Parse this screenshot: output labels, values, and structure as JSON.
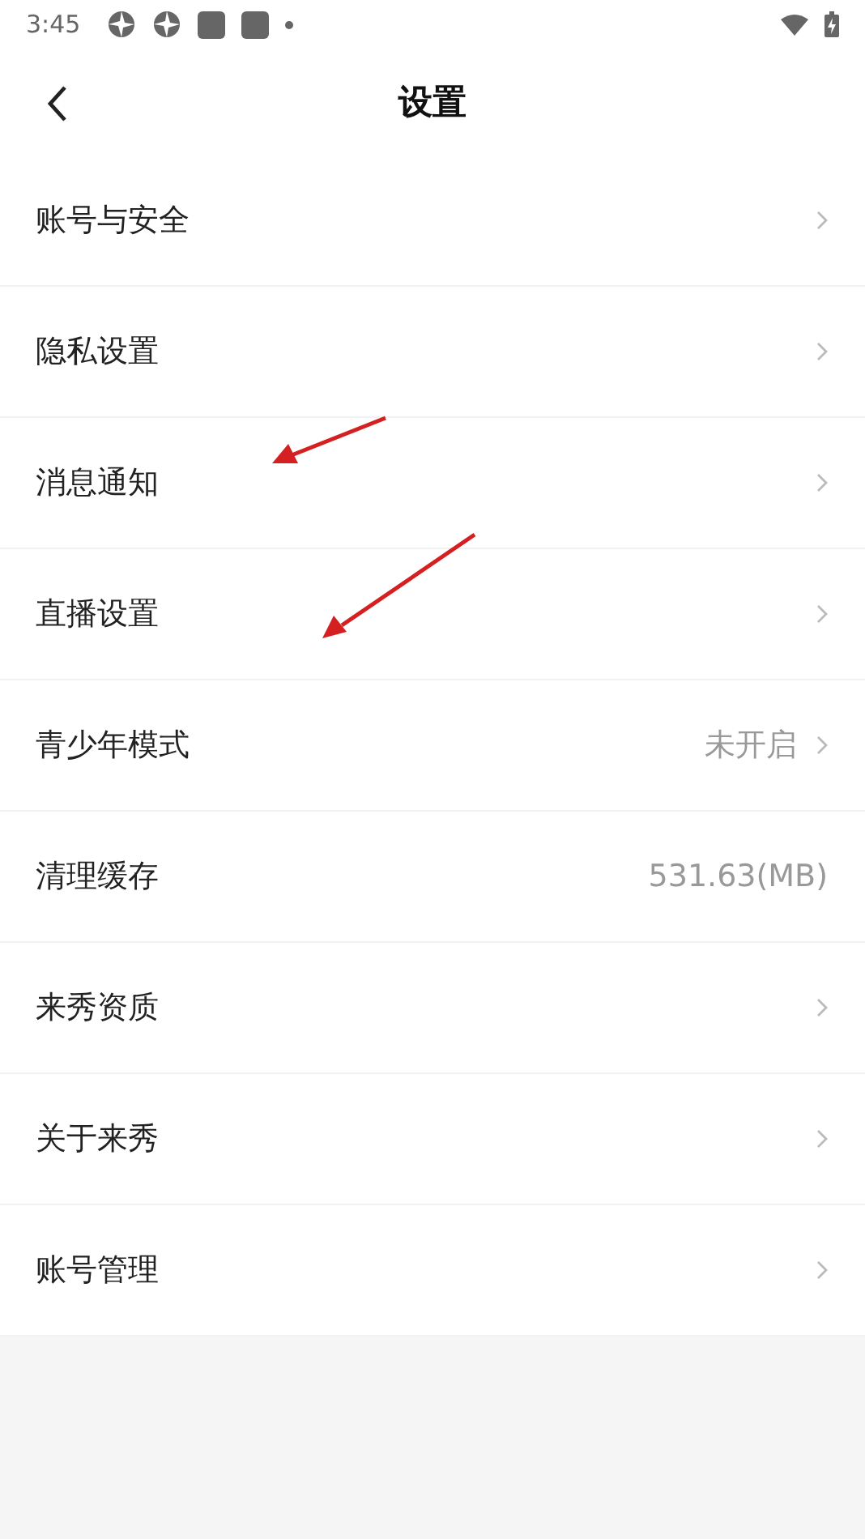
{
  "status_bar": {
    "time": "3:45"
  },
  "header": {
    "title": "设置"
  },
  "items": [
    {
      "label": "账号与安全",
      "chevron": true
    },
    {
      "label": "隐私设置",
      "chevron": true
    },
    {
      "label": "消息通知",
      "chevron": true
    },
    {
      "label": "直播设置",
      "chevron": true
    },
    {
      "label": "青少年模式",
      "value": "未开启",
      "chevron": true
    },
    {
      "label": "清理缓存",
      "value": "531.63(MB)",
      "chevron": false
    },
    {
      "label": "来秀资质",
      "chevron": true
    },
    {
      "label": "关于来秀",
      "chevron": true
    },
    {
      "label": "账号管理",
      "chevron": true
    }
  ]
}
